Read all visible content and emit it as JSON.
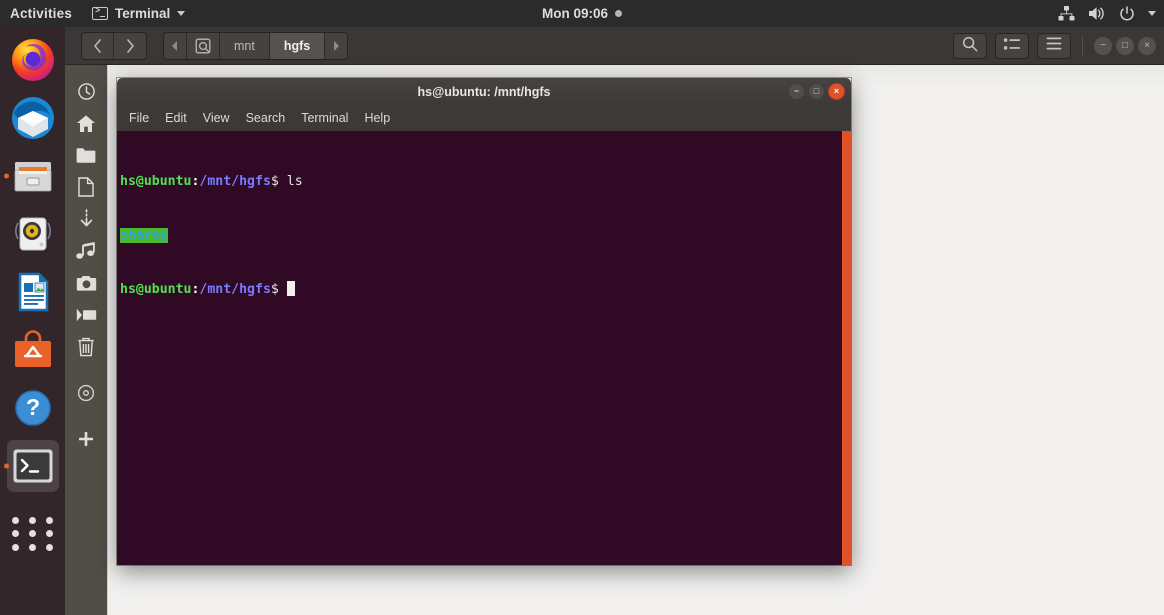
{
  "topbar": {
    "activities": "Activities",
    "app_name": "Terminal",
    "app_icon": "terminal-icon",
    "clock": "Mon 09:06",
    "tray": {
      "network_icon": "network-icon",
      "volume_icon": "volume-icon",
      "power_icon": "power-icon",
      "menu_caret_icon": "chevron-down-icon"
    }
  },
  "dock": {
    "items": [
      {
        "name": "firefox",
        "label": "Firefox",
        "running": false
      },
      {
        "name": "thunderbird",
        "label": "Thunderbird",
        "running": false
      },
      {
        "name": "files",
        "label": "Files",
        "running": true
      },
      {
        "name": "rhythmbox",
        "label": "Rhythmbox",
        "running": false
      },
      {
        "name": "libreoffice-writer",
        "label": "LibreOffice Writer",
        "running": false
      },
      {
        "name": "ubuntu-software",
        "label": "Ubuntu Software",
        "running": false
      },
      {
        "name": "help",
        "label": "Help",
        "running": false
      },
      {
        "name": "terminal",
        "label": "Terminal",
        "running": true
      }
    ],
    "show_apps_label": "Show Applications"
  },
  "nautilus": {
    "back_icon": "chevron-left-icon",
    "forward_icon": "chevron-right-icon",
    "crumb_prev_icon": "chevron-left-small-icon",
    "crumb_next_icon": "chevron-right-small-icon",
    "device_icon": "disk-icon",
    "breadcrumbs": [
      {
        "label": "mnt",
        "active": false
      },
      {
        "label": "hgfs",
        "active": true
      }
    ],
    "tools": {
      "search_icon": "search-icon",
      "view_list_icon": "view-list-icon",
      "menu_icon": "hamburger-menu-icon"
    },
    "window_buttons": {
      "minimize": "−",
      "maximize": "□",
      "close": "×"
    },
    "sidebar": [
      {
        "name": "recent",
        "icon": "clock-icon",
        "label": "Recent"
      },
      {
        "name": "home",
        "icon": "home-icon",
        "label": "Home"
      },
      {
        "name": "documents",
        "icon": "folder-icon",
        "label": "Documents"
      },
      {
        "name": "desktop",
        "icon": "file-icon",
        "label": "Desktop"
      },
      {
        "name": "downloads",
        "icon": "download-arrow-icon",
        "label": "Downloads"
      },
      {
        "name": "music",
        "icon": "music-note-icon",
        "label": "Music"
      },
      {
        "name": "pictures",
        "icon": "camera-icon",
        "label": "Pictures"
      },
      {
        "name": "videos",
        "icon": "video-camera-icon",
        "label": "Videos"
      },
      {
        "name": "trash",
        "icon": "trash-icon",
        "label": "Trash"
      },
      {
        "name": "disc",
        "icon": "disc-icon",
        "label": "CD/DVD"
      },
      {
        "name": "other-locations",
        "icon": "plus-icon",
        "label": "Other Locations"
      }
    ],
    "content_files": []
  },
  "terminal": {
    "title": "hs@ubuntu: /mnt/hgfs",
    "menu": [
      "File",
      "Edit",
      "View",
      "Search",
      "Terminal",
      "Help"
    ],
    "window_buttons": {
      "minimize": "−",
      "maximize": "□",
      "close": "×"
    },
    "lines": [
      {
        "type": "prompt",
        "user": "hs@ubuntu",
        "sep": ":",
        "path": "/mnt/hgfs",
        "dollar": "$ ",
        "command": "ls"
      },
      {
        "type": "output",
        "entries": [
          "sharey"
        ]
      },
      {
        "type": "prompt",
        "user": "hs@ubuntu",
        "sep": ":",
        "path": "/mnt/hgfs",
        "dollar": "$ ",
        "command": ""
      }
    ],
    "scrollbar_color": "#e0512a"
  },
  "colors": {
    "accent": "#e0512a",
    "terminal_bg": "#300a24",
    "prompt_user": "#4ee34e",
    "prompt_path": "#7a7aff",
    "dir_highlight_bg": "#4ab82e",
    "dir_highlight_fg": "#2fa6c7"
  }
}
